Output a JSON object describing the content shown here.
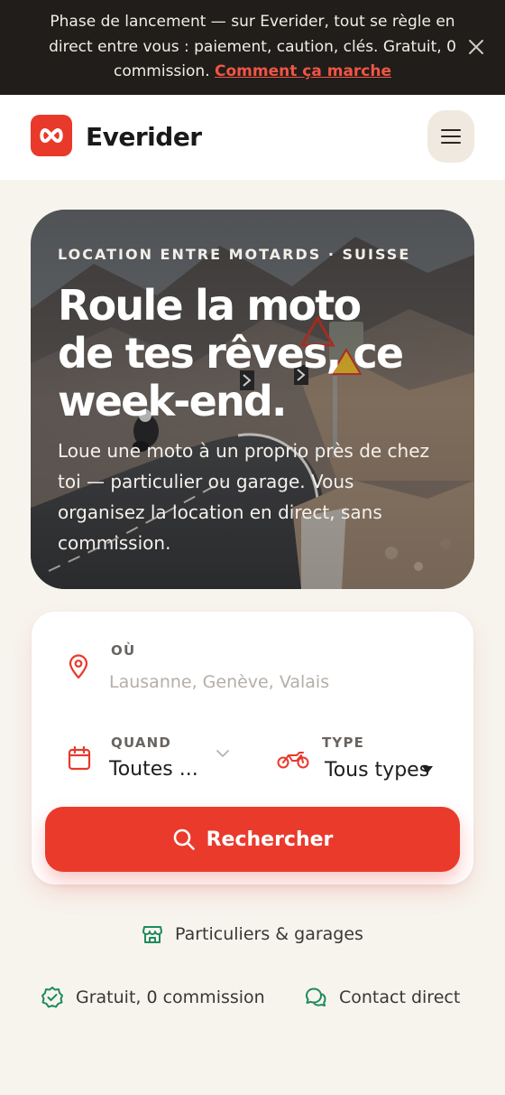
{
  "banner": {
    "text": "Phase de lancement — sur Everider, tout se règle en direct entre vous : paiement, caution, clés. Gratuit, 0 commission.",
    "link": "Comment ça marche"
  },
  "header": {
    "brand": "Everider"
  },
  "hero": {
    "eyebrow": "LOCATION ENTRE MOTARDS · SUISSE",
    "title": "Roule la moto de tes rêves, ce week-end.",
    "subtitle": "Loue une moto à un proprio près de chez toi — particulier ou garage. Vous organisez la location en direct, sans commission."
  },
  "search": {
    "where_label": "OÙ",
    "where_placeholder": "Lausanne, Genève, Valais",
    "when_label": "QUAND",
    "when_value": "Toutes ...",
    "type_label": "TYPE",
    "type_value": "Tous types",
    "button_label": "Rechercher"
  },
  "trust": {
    "item1": "Particuliers & garages",
    "item2": "Gratuit, 0 commission",
    "item3": "Contact direct"
  },
  "colors": {
    "accent": "#ea3a2c",
    "green": "#1f8a5b",
    "banner_bg": "#201d1a",
    "page_bg": "#f7f4ee"
  },
  "icons": [
    "close-icon",
    "infinity-logo-icon",
    "menu-icon",
    "location-pin-icon",
    "calendar-icon",
    "chevron-down-icon",
    "motorcycle-icon",
    "search-icon",
    "store-icon",
    "badge-check-icon",
    "chat-bubbles-icon"
  ]
}
